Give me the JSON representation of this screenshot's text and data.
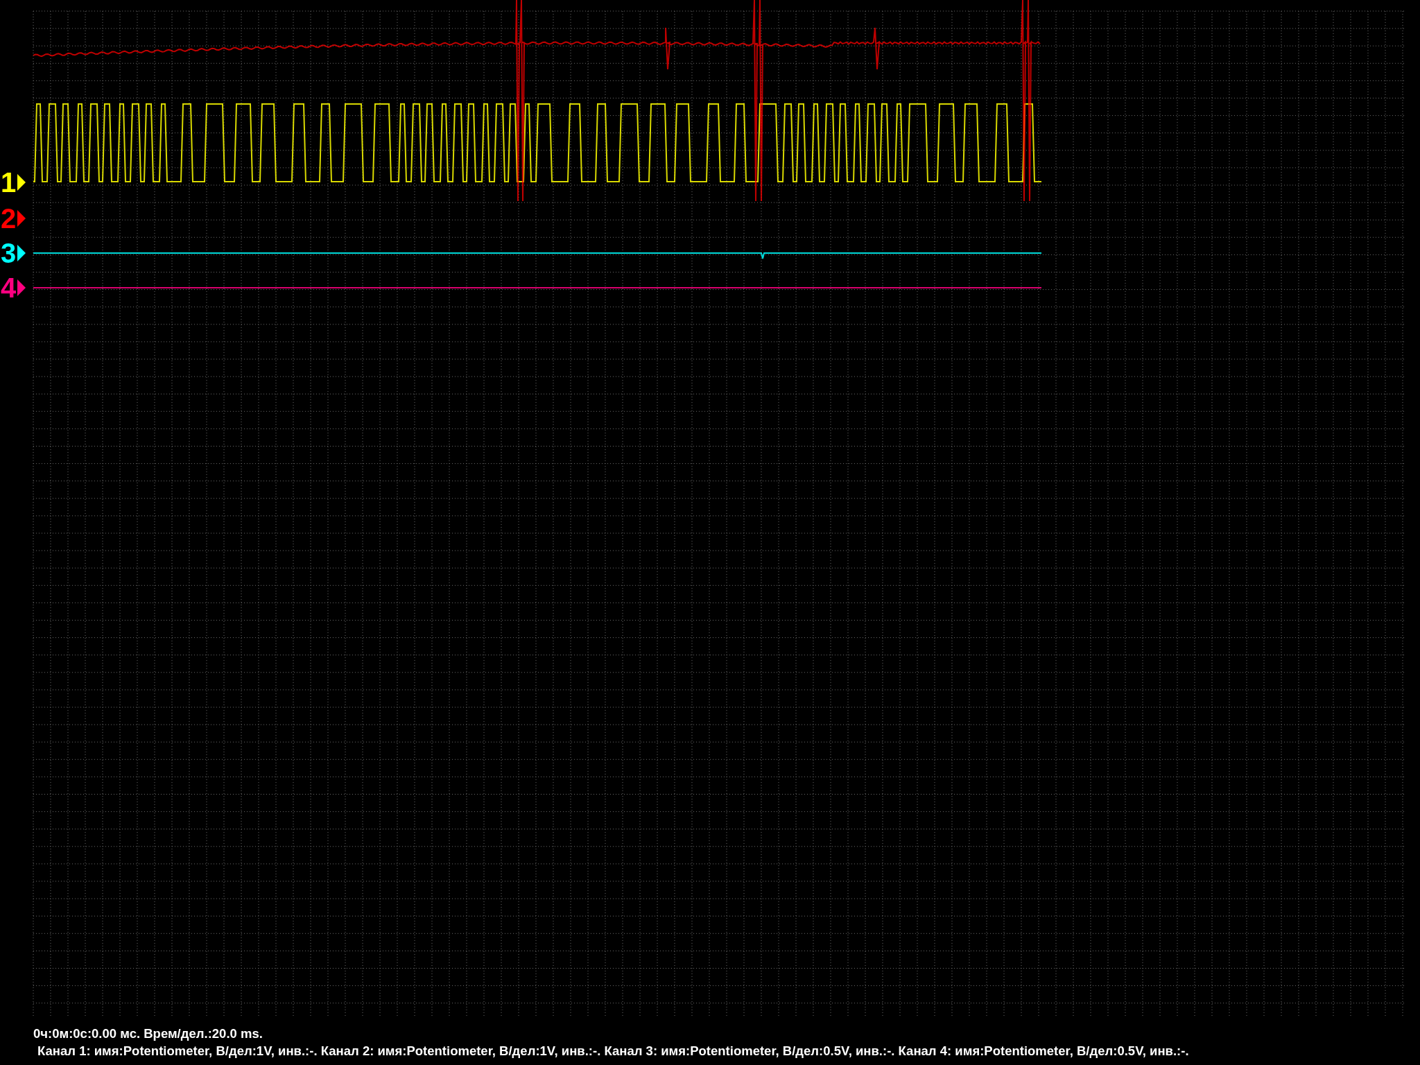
{
  "channels": [
    {
      "label": "1",
      "color": "#ffff00"
    },
    {
      "label": "2",
      "color": "#ff0000"
    },
    {
      "label": "3",
      "color": "#00ffff"
    },
    {
      "label": "4",
      "color": "#ff0080"
    }
  ],
  "status": {
    "time": "0ч:0м:0с:0.00 мс. Врем/дел.:20.0 ms.",
    "channels_info": "Канал 1: имя:Potentiometer, В/дел:1V, инв.:-. Канал 2: имя:Potentiometer, В/дел:1V, инв.:-. Канал 3: имя:Potentiometer, В/дел:0.5V, инв.:-. Канал 4: имя:Potentiometer, В/дел:0.5V, инв.:-."
  }
}
